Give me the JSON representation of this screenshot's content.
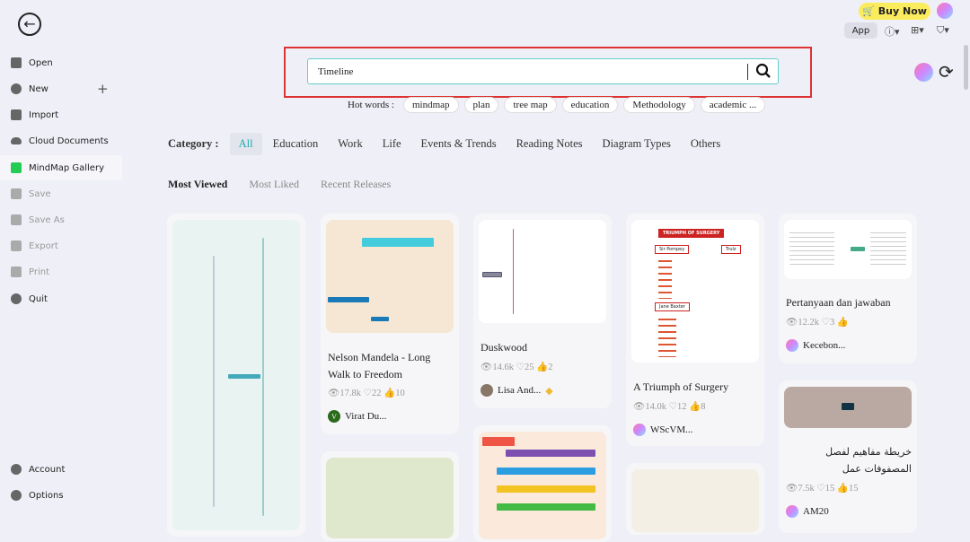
{
  "sidebar": {
    "items": [
      {
        "label": "Open",
        "icon": "folder-icon"
      },
      {
        "label": "New",
        "icon": "plus-circle-icon"
      },
      {
        "label": "Import",
        "icon": "import-icon"
      },
      {
        "label": "Cloud Documents",
        "icon": "cloud-icon"
      },
      {
        "label": "MindMap Gallery",
        "icon": "gallery-icon"
      },
      {
        "label": "Save",
        "icon": "save-icon"
      },
      {
        "label": "Save As",
        "icon": "save-as-icon"
      },
      {
        "label": "Export",
        "icon": "export-icon"
      },
      {
        "label": "Print",
        "icon": "print-icon"
      },
      {
        "label": "Quit",
        "icon": "minus-circle-icon"
      }
    ],
    "bottom": [
      {
        "label": "Account"
      },
      {
        "label": "Options"
      }
    ]
  },
  "header": {
    "buy_now": "Buy Now",
    "app": "App"
  },
  "search": {
    "value": "Timeline"
  },
  "hot_words": {
    "label": "Hot words :",
    "items": [
      "mindmap",
      "plan",
      "tree map",
      "education",
      "Methodology",
      "academic ..."
    ]
  },
  "category": {
    "label": "Category :",
    "items": [
      "All",
      "Education",
      "Work",
      "Life",
      "Events & Trends",
      "Reading Notes",
      "Diagram Types",
      "Others"
    ],
    "selected": "All"
  },
  "sort": {
    "items": [
      "Most Viewed",
      "Most Liked",
      "Recent Releases"
    ],
    "selected": "Most Viewed"
  },
  "cards": [
    {
      "title": "Nelson Mandela - Long Walk to Freedom",
      "views": "17.8k",
      "likes": "22",
      "thumbs": "10",
      "author": "Virat Du...",
      "initial": "V"
    },
    {
      "title": "Duskwood",
      "views": "14.6k",
      "likes": "25",
      "thumbs": "2",
      "author": "Lisa And..."
    },
    {
      "title": "A Triumph of Surgery",
      "views": "14.0k",
      "likes": "12",
      "thumbs": "8",
      "author": "WScVM..."
    },
    {
      "title": "Pertanyaan dan jawaban",
      "views": "12.2k",
      "likes": "3",
      "thumbs": "",
      "author": "Kecebon..."
    },
    {
      "title": "خريطة مفاهيم لفصل المصفوفات عمل",
      "views": "7.5k",
      "likes": "15",
      "thumbs": "15",
      "author": "AM20"
    }
  ],
  "thumb_text": {
    "surgery_title": "TRIUMPH OF SURGERY",
    "surgery_a": "Sir Pompey",
    "surgery_b": "Trulz",
    "surgery_c": "Jane Baxter"
  },
  "colors": {
    "accent": "#22aaaa",
    "buy": "#fbec5d",
    "highlight": "#dd3333"
  }
}
